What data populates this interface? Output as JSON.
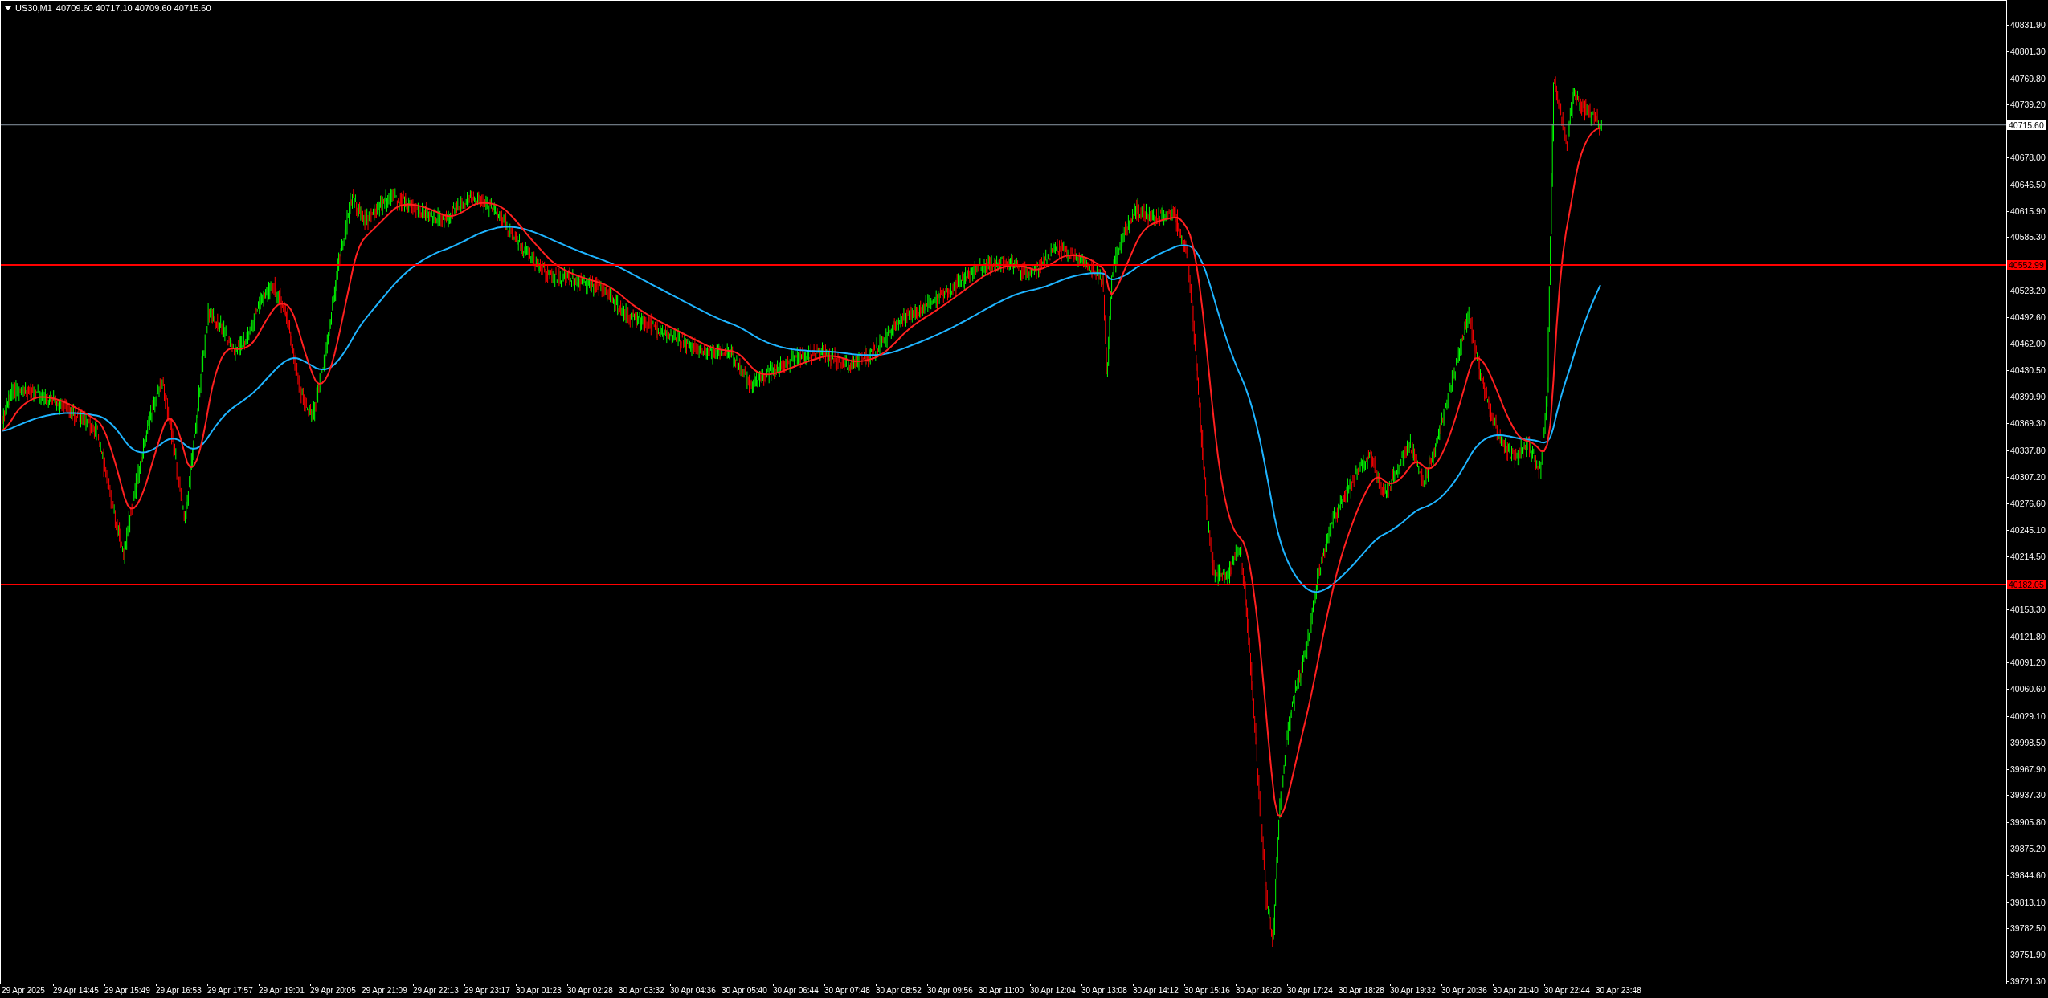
{
  "chart_header": {
    "symbol": "US30,M1",
    "ohlc": "40709.60 40717.10 40709.60 40715.60"
  },
  "price_axis": {
    "ticks": [
      "40831.90",
      "40801.30",
      "40769.80",
      "40739.20",
      "40678.00",
      "40646.50",
      "40615.90",
      "40585.30",
      "40523.20",
      "40492.60",
      "40462.00",
      "40430.50",
      "40399.90",
      "40369.30",
      "40337.80",
      "40307.20",
      "40276.60",
      "40245.10",
      "40214.50",
      "40153.30",
      "40121.80",
      "40091.20",
      "40060.60",
      "40029.10",
      "39998.50",
      "39967.90",
      "39937.30",
      "39905.80",
      "39875.20",
      "39844.60",
      "39813.10",
      "39782.50",
      "39751.90",
      "39721.30"
    ]
  },
  "time_axis": {
    "ticks": [
      "29 Apr 2025",
      "29 Apr 14:45",
      "29 Apr 15:49",
      "29 Apr 16:53",
      "29 Apr 17:57",
      "29 Apr 19:01",
      "29 Apr 20:05",
      "29 Apr 21:09",
      "29 Apr 22:13",
      "29 Apr 23:17",
      "30 Apr 01:23",
      "30 Apr 02:28",
      "30 Apr 03:32",
      "30 Apr 04:36",
      "30 Apr 05:40",
      "30 Apr 06:44",
      "30 Apr 07:48",
      "30 Apr 08:52",
      "30 Apr 09:56",
      "30 Apr 11:00",
      "30 Apr 12:04",
      "30 Apr 13:08",
      "30 Apr 14:12",
      "30 Apr 15:16",
      "30 Apr 16:20",
      "30 Apr 17:24",
      "30 Apr 18:28",
      "30 Apr 19:32",
      "30 Apr 20:36",
      "30 Apr 21:40",
      "30 Apr 22:44",
      "30 Apr 23:48"
    ]
  },
  "horizontal_lines": [
    {
      "kind": "bid",
      "price_label": "40715.60"
    },
    {
      "kind": "level",
      "price_label": "40552.99"
    },
    {
      "kind": "level",
      "price_label": "40182.05"
    }
  ]
}
